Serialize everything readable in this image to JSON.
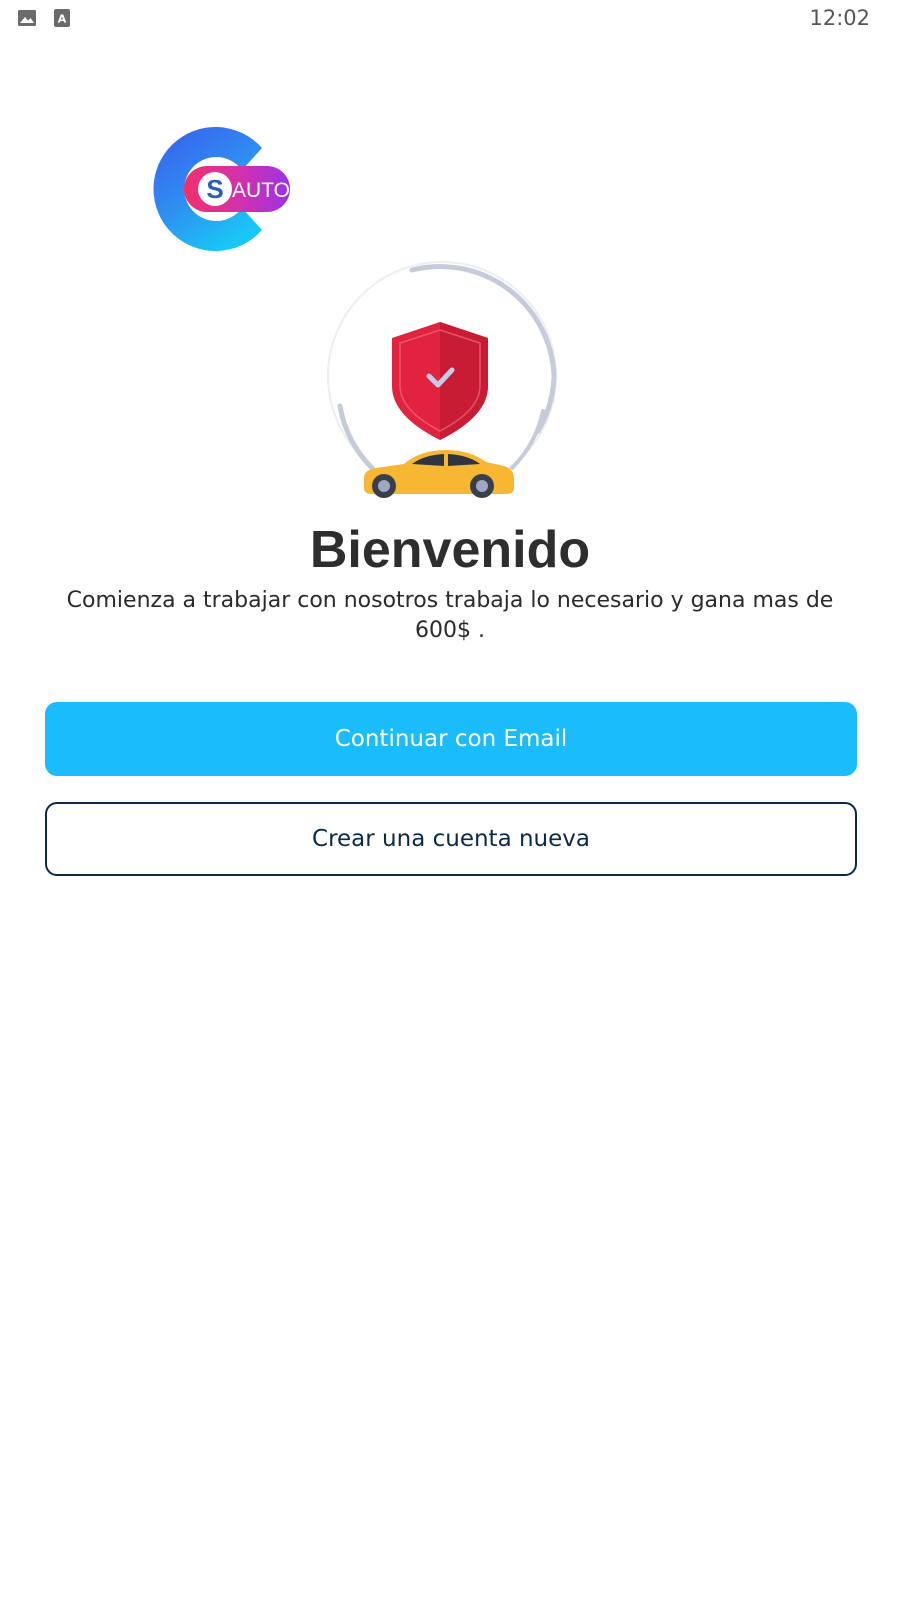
{
  "status_bar": {
    "time": "12:02",
    "icons": [
      "image-icon",
      "text-a-icon"
    ]
  },
  "brand": {
    "logo_letter": "S",
    "logo_text": "AUTO"
  },
  "welcome": {
    "title": "Bienvenido",
    "subtitle": "Comienza a trabajar con nosotros trabaja lo necesario y gana mas de 600$ ."
  },
  "actions": {
    "email_button_label": "Continuar con Email",
    "create_account_label": "Crear una cuenta nueva"
  },
  "colors": {
    "primary": "#1bbcfb",
    "outline": "#0b2a4a",
    "shield": "#e1233f",
    "car": "#f7b733"
  }
}
